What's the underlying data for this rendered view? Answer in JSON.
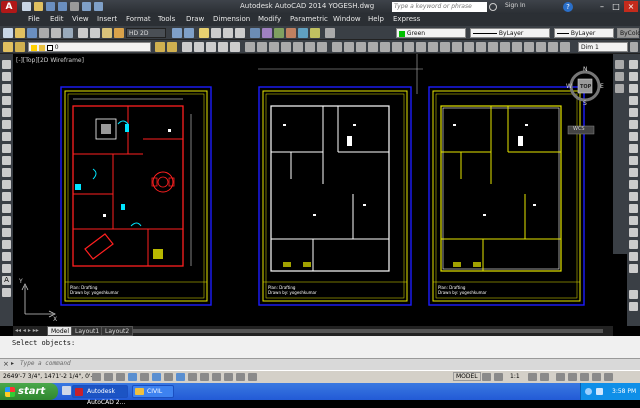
{
  "app": {
    "window_title": "Autodesk AutoCAD 2014   YOGESH.dwg",
    "search_placeholder": "Type a keyword or phrase",
    "sign_in": "Sign In",
    "help_icon": "?"
  },
  "menu": [
    "File",
    "Edit",
    "View",
    "Insert",
    "Format",
    "Tools",
    "Draw",
    "Dimension",
    "Modify",
    "Parametric",
    "Window",
    "Help",
    "Express"
  ],
  "toolbar": {
    "visual_style": "HD 2D",
    "layer_value": "0",
    "color_value": "Green",
    "linetype_value": "ByLayer",
    "lineweight_value": "ByLayer",
    "plotstyle_value": "ByColor",
    "dimstyle_value": "Dim 1"
  },
  "viewport": {
    "label": "[-][Top][2D Wireframe]",
    "viewcube_face": "TOP",
    "viewcube_n": "N",
    "viewcube_w": "W",
    "viewcube_e": "E",
    "viewcube_s": "S",
    "wcs": "WCS",
    "ucs_y": "Y",
    "ucs_x": "X"
  },
  "sheets": [
    {
      "title": "Plan: Drafting",
      "subtitle": "Drawn by: yogeshkumar"
    },
    {
      "title": "Plan: Drafting",
      "subtitle": "Drawn by: yogeshkumar"
    },
    {
      "title": "Plan: Drafting",
      "subtitle": "Drawn by: yogeshkumar"
    }
  ],
  "layout_tabs": [
    "Model",
    "Layout1",
    "Layout2"
  ],
  "command": {
    "history": "Select objects:",
    "prompt": "Type a command"
  },
  "status": {
    "coords": "2649'-7 3/4\", 1471'-2 1/4\", 0'-0\"",
    "model": "MODEL",
    "scale": "1:1"
  },
  "taskbar": {
    "start": "start",
    "tasks": [
      "Autodesk AutoCAD 2...",
      "CIVIL"
    ],
    "clock": "3:58 PM"
  },
  "colors": {
    "drawing_bg": "#000000",
    "border_yellow": "#e6e600",
    "border_blue": "#1c1cff",
    "wall_red": "#ff2020",
    "wall_white": "#ffffff",
    "cyan": "#00e5ff"
  }
}
